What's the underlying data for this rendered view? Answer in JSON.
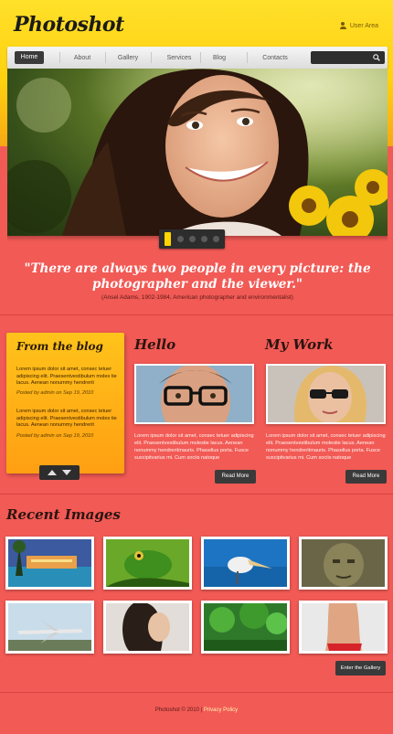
{
  "header": {
    "logo": "Photoshot",
    "user_area": "User Area"
  },
  "nav": {
    "items": [
      "Home",
      "About",
      "Gallery",
      "Services",
      "Blog",
      "Contacts"
    ],
    "active": "Home",
    "search_placeholder": ""
  },
  "hero": {
    "slides_count": 5,
    "active_slide": 1
  },
  "quote": {
    "text": "\"There are always two people in every picture: the photographer and the viewer.\"",
    "credit": "(Ansel Adams, 1902-1984, American photographer and environmentalist)"
  },
  "blog": {
    "title": "From the blog",
    "posts": [
      {
        "text": "Lorem ipsum dolor sit amet, consec tetuer adipiscing elit. Praesentvestibulum moles tie lacus. Aenean nonummy hendrerit",
        "meta": "Posted by admin on Sep 19, 2010"
      },
      {
        "text": "Lorem ipsum dolor sit amet, consec tetuer adipiscing elit. Praesentvestibulum moles tie lacus. Aenean nonummy hendrerit",
        "meta": "Posted by admin on Sep 19, 2010"
      }
    ]
  },
  "hello": {
    "title": "Hello",
    "text": "Lorem ipsum dolor sit amet, consec tetuer adipiscing elit. Praesentvestibulum molestie lacus. Aenean nonummy hendreritmauris. Phasellus porta. Fusce suscipitvarius mi. Cum sociis natoque",
    "button": "Read More"
  },
  "work": {
    "title": "My Work",
    "text": "Lorem ipsum dolor sit amet, consec tetuer adipiscing elit. Praesentvestibulum molestie lacus. Aenean nonummy hendreritmauris. Phasellus porta. Fusce suscipitvarius mi. Cum sociis natoque",
    "button": "Read More"
  },
  "recent": {
    "title": "Recent Images",
    "button": "Enter the Gallery"
  },
  "footer": {
    "copyright": "Photoshot © 2010 |",
    "link": "Privacy Policy"
  },
  "colors": {
    "accent": "#ffd400",
    "background": "#f25a55",
    "dark": "#3a3a3a"
  }
}
